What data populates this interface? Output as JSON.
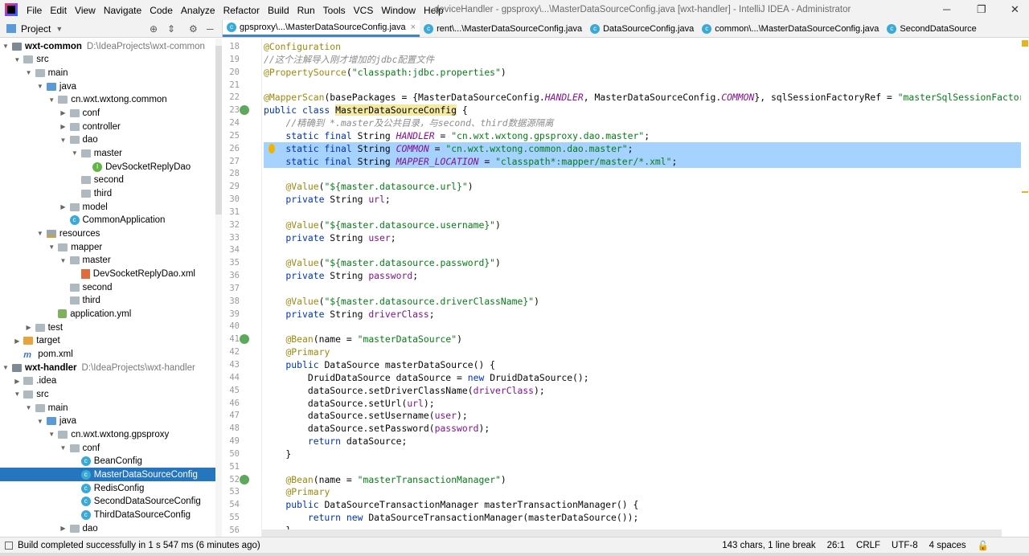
{
  "menu": [
    "File",
    "Edit",
    "View",
    "Navigate",
    "Code",
    "Analyze",
    "Refactor",
    "Build",
    "Run",
    "Tools",
    "VCS",
    "Window",
    "Help"
  ],
  "window_title": "deviceHandler - gpsproxy\\...\\MasterDataSourceConfig.java [wxt-handler] - IntelliJ IDEA - Administrator",
  "project_panel": {
    "title": "Project"
  },
  "tree": [
    {
      "level": 0,
      "arrow": "open",
      "icon": "module",
      "label": "wxt-common",
      "path": "D:\\IdeaProjects\\wxt-common",
      "bold": true
    },
    {
      "level": 1,
      "arrow": "open",
      "icon": "folder",
      "label": "src"
    },
    {
      "level": 2,
      "arrow": "open",
      "icon": "folder",
      "label": "main"
    },
    {
      "level": 3,
      "arrow": "open",
      "icon": "src",
      "label": "java"
    },
    {
      "level": 4,
      "arrow": "open",
      "icon": "folder",
      "label": "cn.wxt.wxtong.common"
    },
    {
      "level": 5,
      "arrow": "closed",
      "icon": "folder",
      "label": "conf"
    },
    {
      "level": 5,
      "arrow": "closed",
      "icon": "folder",
      "label": "controller"
    },
    {
      "level": 5,
      "arrow": "open",
      "icon": "folder",
      "label": "dao"
    },
    {
      "level": 6,
      "arrow": "open",
      "icon": "folder",
      "label": "master"
    },
    {
      "level": 7,
      "arrow": "none",
      "icon": "interface",
      "label": "DevSocketReplyDao"
    },
    {
      "level": 6,
      "arrow": "none",
      "icon": "folder",
      "label": "second"
    },
    {
      "level": 6,
      "arrow": "none",
      "icon": "folder",
      "label": "third"
    },
    {
      "level": 5,
      "arrow": "closed",
      "icon": "folder",
      "label": "model"
    },
    {
      "level": 5,
      "arrow": "none",
      "icon": "class",
      "label": "CommonApplication"
    },
    {
      "level": 3,
      "arrow": "open",
      "icon": "res",
      "label": "resources"
    },
    {
      "level": 4,
      "arrow": "open",
      "icon": "folder",
      "label": "mapper"
    },
    {
      "level": 5,
      "arrow": "open",
      "icon": "folder",
      "label": "master"
    },
    {
      "level": 6,
      "arrow": "none",
      "icon": "xml",
      "label": "DevSocketReplyDao.xml"
    },
    {
      "level": 5,
      "arrow": "none",
      "icon": "folder",
      "label": "second"
    },
    {
      "level": 5,
      "arrow": "none",
      "icon": "folder",
      "label": "third"
    },
    {
      "level": 4,
      "arrow": "none",
      "icon": "yml",
      "label": "application.yml"
    },
    {
      "level": 2,
      "arrow": "closed",
      "icon": "folder",
      "label": "test"
    },
    {
      "level": 1,
      "arrow": "closed",
      "icon": "orange",
      "label": "target"
    },
    {
      "level": 1,
      "arrow": "none",
      "icon": "pom",
      "label": "pom.xml"
    },
    {
      "level": 0,
      "arrow": "open",
      "icon": "module",
      "label": "wxt-handler",
      "path": "D:\\IdeaProjects\\wxt-handler",
      "bold": true
    },
    {
      "level": 1,
      "arrow": "closed",
      "icon": "folder",
      "label": ".idea"
    },
    {
      "level": 1,
      "arrow": "open",
      "icon": "folder",
      "label": "src"
    },
    {
      "level": 2,
      "arrow": "open",
      "icon": "folder",
      "label": "main"
    },
    {
      "level": 3,
      "arrow": "open",
      "icon": "src",
      "label": "java"
    },
    {
      "level": 4,
      "arrow": "open",
      "icon": "folder",
      "label": "cn.wxt.wxtong.gpsproxy"
    },
    {
      "level": 5,
      "arrow": "open",
      "icon": "folder",
      "label": "conf"
    },
    {
      "level": 6,
      "arrow": "none",
      "icon": "class",
      "label": "BeanConfig"
    },
    {
      "level": 6,
      "arrow": "none",
      "icon": "class",
      "label": "MasterDataSourceConfig",
      "selected": true
    },
    {
      "level": 6,
      "arrow": "none",
      "icon": "class",
      "label": "RedisConfig"
    },
    {
      "level": 6,
      "arrow": "none",
      "icon": "class",
      "label": "SecondDataSourceConfig"
    },
    {
      "level": 6,
      "arrow": "none",
      "icon": "class",
      "label": "ThirdDataSourceConfig"
    },
    {
      "level": 5,
      "arrow": "closed",
      "icon": "folder",
      "label": "dao"
    }
  ],
  "tabs": [
    {
      "label": "gpsproxy\\...\\MasterDataSourceConfig.java",
      "active": true,
      "close": "×"
    },
    {
      "label": "rent\\...\\MasterDataSourceConfig.java"
    },
    {
      "label": "DataSourceConfig.java"
    },
    {
      "label": "common\\...\\MasterDataSourceConfig.java"
    },
    {
      "label": "SecondDataSource"
    }
  ],
  "code": {
    "first_line": 18,
    "highlighted_lines": [
      26,
      27
    ],
    "gutter_icons": {
      "23": "bean-class-icon",
      "41": "bean-icon",
      "52": "bean-icon",
      "26": "lightbulb-icon"
    },
    "lines": [
      [
        [
          "ann",
          "@Configuration"
        ]
      ],
      [
        [
          "cm",
          "//这个注解导入刚才增加的jdbc配置文件"
        ]
      ],
      [
        [
          "ann",
          "@PropertySource"
        ],
        [
          "plain",
          "("
        ],
        [
          "str",
          "\"classpath:jdbc.properties\""
        ],
        [
          "plain",
          ")"
        ]
      ],
      [],
      [
        [
          "ann",
          "@MapperScan"
        ],
        [
          "plain",
          "(basePackages = {MasterDataSourceConfig."
        ],
        [
          "cst",
          "HANDLER"
        ],
        [
          "plain",
          ", MasterDataSourceConfig."
        ],
        [
          "cst",
          "COMMON"
        ],
        [
          "plain",
          "}, sqlSessionFactoryRef = "
        ],
        [
          "str",
          "\"masterSqlSessionFactory\""
        ],
        [
          "plain",
          ")"
        ]
      ],
      [
        [
          "kw",
          "public class "
        ],
        [
          "clsh",
          "MasterDataSourceConfig"
        ],
        [
          "plain",
          " {"
        ]
      ],
      [
        [
          "plain",
          "    "
        ],
        [
          "cm",
          "//精确到 *.master及公共目录，与second、third数据源隔离"
        ]
      ],
      [
        [
          "kw",
          "    static final "
        ],
        [
          "plain",
          "String "
        ],
        [
          "cst",
          "HANDLER"
        ],
        [
          "plain",
          " = "
        ],
        [
          "str",
          "\"cn.wxt.wxtong.gpsproxy.dao.master\""
        ],
        [
          "plain",
          ";"
        ]
      ],
      [
        [
          "kw",
          "    static final "
        ],
        [
          "plain",
          "String "
        ],
        [
          "cst",
          "COMMON"
        ],
        [
          "plain",
          " = "
        ],
        [
          "str",
          "\"cn.wxt.wxtong.common.dao.master\""
        ],
        [
          "plain",
          ";"
        ]
      ],
      [
        [
          "kw",
          "    static final "
        ],
        [
          "plain",
          "String "
        ],
        [
          "cst",
          "MAPPER_LOCATION"
        ],
        [
          "plain",
          " = "
        ],
        [
          "str",
          "\"classpath*:mapper/master/*.xml\""
        ],
        [
          "plain",
          ";"
        ]
      ],
      [],
      [
        [
          "plain",
          "    "
        ],
        [
          "ann",
          "@Value"
        ],
        [
          "plain",
          "("
        ],
        [
          "str",
          "\"${master.datasource.url}\""
        ],
        [
          "plain",
          ")"
        ]
      ],
      [
        [
          "kw",
          "    private "
        ],
        [
          "plain",
          "String "
        ],
        [
          "fld",
          "url"
        ],
        [
          "plain",
          ";"
        ]
      ],
      [],
      [
        [
          "plain",
          "    "
        ],
        [
          "ann",
          "@Value"
        ],
        [
          "plain",
          "("
        ],
        [
          "str",
          "\"${master.datasource.username}\""
        ],
        [
          "plain",
          ")"
        ]
      ],
      [
        [
          "kw",
          "    private "
        ],
        [
          "plain",
          "String "
        ],
        [
          "fld",
          "user"
        ],
        [
          "plain",
          ";"
        ]
      ],
      [],
      [
        [
          "plain",
          "    "
        ],
        [
          "ann",
          "@Value"
        ],
        [
          "plain",
          "("
        ],
        [
          "str",
          "\"${master.datasource.password}\""
        ],
        [
          "plain",
          ")"
        ]
      ],
      [
        [
          "kw",
          "    private "
        ],
        [
          "plain",
          "String "
        ],
        [
          "fld",
          "password"
        ],
        [
          "plain",
          ";"
        ]
      ],
      [],
      [
        [
          "plain",
          "    "
        ],
        [
          "ann",
          "@Value"
        ],
        [
          "plain",
          "("
        ],
        [
          "str",
          "\"${master.datasource.driverClassName}\""
        ],
        [
          "plain",
          ")"
        ]
      ],
      [
        [
          "kw",
          "    private "
        ],
        [
          "plain",
          "String "
        ],
        [
          "fld",
          "driverClass"
        ],
        [
          "plain",
          ";"
        ]
      ],
      [],
      [
        [
          "plain",
          "    "
        ],
        [
          "ann",
          "@Bean"
        ],
        [
          "plain",
          "(name = "
        ],
        [
          "str",
          "\"masterDataSource\""
        ],
        [
          "plain",
          ")"
        ]
      ],
      [
        [
          "plain",
          "    "
        ],
        [
          "ann",
          "@Primary"
        ]
      ],
      [
        [
          "kw",
          "    public "
        ],
        [
          "plain",
          "DataSource masterDataSource() {"
        ]
      ],
      [
        [
          "plain",
          "        DruidDataSource dataSource = "
        ],
        [
          "kw",
          "new "
        ],
        [
          "plain",
          "DruidDataSource();"
        ]
      ],
      [
        [
          "plain",
          "        dataSource.setDriverClassName("
        ],
        [
          "fld",
          "driverClass"
        ],
        [
          "plain",
          ");"
        ]
      ],
      [
        [
          "plain",
          "        dataSource.setUrl("
        ],
        [
          "fld",
          "url"
        ],
        [
          "plain",
          ");"
        ]
      ],
      [
        [
          "plain",
          "        dataSource.setUsername("
        ],
        [
          "fld",
          "user"
        ],
        [
          "plain",
          ");"
        ]
      ],
      [
        [
          "plain",
          "        dataSource.setPassword("
        ],
        [
          "fld",
          "password"
        ],
        [
          "plain",
          ");"
        ]
      ],
      [
        [
          "kw",
          "        return "
        ],
        [
          "plain",
          "dataSource;"
        ]
      ],
      [
        [
          "plain",
          "    }"
        ]
      ],
      [],
      [
        [
          "plain",
          "    "
        ],
        [
          "ann",
          "@Bean"
        ],
        [
          "plain",
          "(name = "
        ],
        [
          "str",
          "\"masterTransactionManager\""
        ],
        [
          "plain",
          ")"
        ]
      ],
      [
        [
          "plain",
          "    "
        ],
        [
          "ann",
          "@Primary"
        ]
      ],
      [
        [
          "kw",
          "    public "
        ],
        [
          "plain",
          "DataSourceTransactionManager masterTransactionManager() {"
        ]
      ],
      [
        [
          "kw",
          "        return new "
        ],
        [
          "plain",
          "DataSourceTransactionManager(masterDataSource());"
        ]
      ],
      [
        [
          "plain",
          "    }"
        ]
      ]
    ]
  },
  "status": {
    "message": "Build completed successfully in 1 s 547 ms (6 minutes ago)",
    "selection": "143 chars, 1 line break",
    "position": "26:1",
    "line_separator": "CRLF",
    "encoding": "UTF-8",
    "indent": "4 spaces"
  },
  "colors": {
    "selection": "#a6d2ff",
    "tree_selected": "#2675bf",
    "active_tab_underline": "#4083c9"
  }
}
